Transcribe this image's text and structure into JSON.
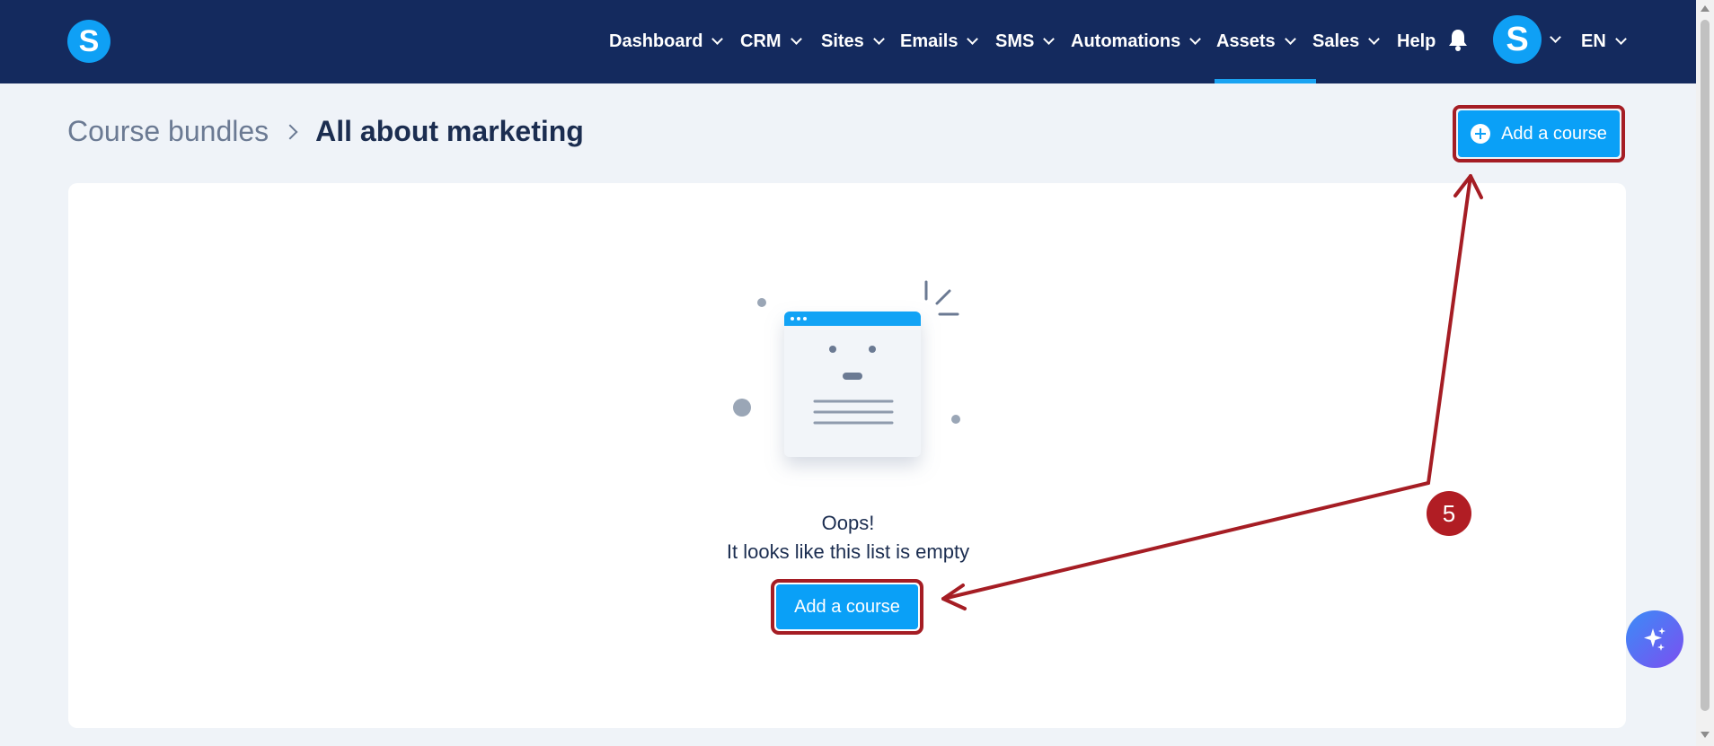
{
  "nav": {
    "logo_letter": "S",
    "items": [
      {
        "label": "Dashboard",
        "has_dropdown": true
      },
      {
        "label": "CRM",
        "has_dropdown": true
      },
      {
        "label": "Sites",
        "has_dropdown": true
      },
      {
        "label": "Emails",
        "has_dropdown": true
      },
      {
        "label": "SMS",
        "has_dropdown": true
      },
      {
        "label": "Automations",
        "has_dropdown": true
      },
      {
        "label": "Assets",
        "has_dropdown": true,
        "active": true
      },
      {
        "label": "Sales",
        "has_dropdown": true
      },
      {
        "label": "Help",
        "has_dropdown": false
      }
    ],
    "avatar_letter": "S",
    "language": "EN"
  },
  "breadcrumb": {
    "parent": "Course bundles",
    "current": "All about marketing"
  },
  "header_button_label": "Add a course",
  "empty_state": {
    "title": "Oops!",
    "subtitle": "It looks like this list is empty",
    "button_label": "Add a course"
  },
  "annotation": {
    "step_number": "5",
    "color": "#b11d24"
  },
  "colors": {
    "nav_bg": "#142a5e",
    "primary": "#0aa0f7",
    "page_bg": "#eff3f8"
  }
}
